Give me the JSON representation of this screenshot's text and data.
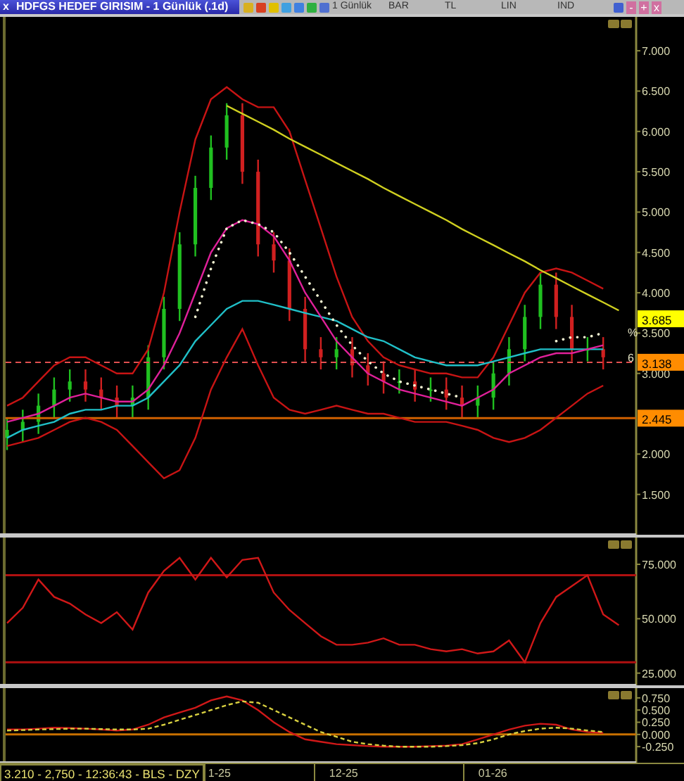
{
  "window": {
    "close": "x",
    "title": "HDFGS HEDEF GIRISIM - 1 Günlük (.1d)"
  },
  "toolbar": {
    "menus": [
      "1 Günlük",
      "BAR",
      "TL",
      "LIN",
      "IND"
    ],
    "window_buttons": [
      "-",
      "+",
      "x"
    ]
  },
  "panels": [
    {
      "layers": [
        {
          "chart_data": {
            "type": "candlestick",
            "ylim": [
              1.0,
              7.42
            ],
            "yticks": [
              {
                "value": 7,
                "label": "7.000"
              },
              {
                "value": 6.5,
                "label": "6.500"
              },
              {
                "value": 6,
                "label": "6.000"
              },
              {
                "value": 5.5,
                "label": "5.500"
              },
              {
                "value": 5,
                "label": "5.000"
              }
            ],
            "ohlc": [
              [
                2.2,
                2.45,
                2.05,
                2.3
              ],
              [
                2.3,
                2.55,
                2.15,
                2.4
              ],
              [
                2.4,
                2.75,
                2.25,
                2.6
              ],
              [
                2.6,
                2.95,
                2.45,
                2.8
              ],
              [
                2.8,
                3.05,
                2.65,
                2.9
              ],
              [
                2.9,
                3.05,
                2.65,
                2.8
              ],
              [
                2.8,
                2.95,
                2.55,
                2.7
              ],
              [
                2.7,
                2.85,
                2.45,
                2.6
              ],
              [
                2.6,
                2.85,
                2.45,
                2.7
              ],
              [
                2.7,
                3.35,
                2.55,
                3.2
              ],
              [
                3.2,
                3.95,
                3.05,
                3.8
              ],
              [
                3.8,
                4.75,
                3.65,
                4.6
              ],
              [
                4.6,
                5.45,
                4.45,
                5.3
              ],
              [
                5.3,
                5.95,
                5.15,
                5.8
              ],
              [
                5.8,
                6.35,
                5.65,
                6.2
              ],
              [
                6.2,
                6.35,
                5.35,
                5.5
              ],
              [
                5.5,
                5.65,
                4.45,
                4.6
              ],
              [
                4.6,
                4.75,
                4.25,
                4.4
              ],
              [
                4.4,
                4.55,
                3.65,
                3.8
              ],
              [
                3.8,
                3.95,
                3.15,
                3.3
              ],
              [
                3.3,
                3.45,
                3.05,
                3.2
              ],
              [
                3.2,
                3.45,
                3.05,
                3.3
              ],
              [
                3.3,
                3.45,
                2.95,
                3.1
              ],
              [
                3.1,
                3.25,
                2.85,
                3.0
              ],
              [
                3.0,
                3.15,
                2.75,
                2.9
              ],
              [
                2.9,
                3.05,
                2.75,
                2.9
              ],
              [
                2.9,
                3.05,
                2.65,
                2.8
              ],
              [
                2.8,
                2.95,
                2.65,
                2.8
              ],
              [
                2.8,
                2.95,
                2.55,
                2.7
              ],
              [
                2.7,
                2.85,
                2.45,
                2.6
              ],
              [
                2.6,
                2.85,
                2.45,
                2.7
              ],
              [
                2.7,
                3.15,
                2.55,
                3.0
              ],
              [
                3.0,
                3.45,
                2.85,
                3.3
              ],
              [
                3.3,
                3.85,
                3.15,
                3.7
              ],
              [
                3.7,
                4.25,
                3.55,
                4.1
              ],
              [
                4.1,
                4.25,
                3.55,
                3.7
              ],
              [
                3.7,
                3.85,
                3.15,
                3.3
              ],
              [
                3.3,
                3.45,
                3.15,
                3.3
              ],
              [
                3.3,
                3.45,
                3.05,
                3.2
              ]
            ]
          }
        },
        {
          "chart_data": {
            "type": "line",
            "ylim": [
              1.0,
              7.42
            ],
            "yticks": [
              {
                "value": 4.5,
                "label": "4.500"
              },
              {
                "value": 4,
                "label": "4.000"
              },
              {
                "value": 3.5,
                "label": "3.500"
              },
              {
                "value": 3,
                "label": "3.000"
              },
              {
                "value": 2,
                "label": "2.000"
              },
              {
                "value": 1.5,
                "label": "1.500"
              }
            ],
            "series": [
              {
                "color": "#c81414",
                "line_style": "solid",
                "values": [
                  2.6,
                  2.7,
                  2.9,
                  3.1,
                  3.2,
                  3.2,
                  3.1,
                  3.0,
                  3.0,
                  3.3,
                  4.0,
                  5.0,
                  5.9,
                  6.4,
                  6.55,
                  6.4,
                  6.3,
                  6.3,
                  6.0,
                  5.4,
                  4.8,
                  4.2,
                  3.7,
                  3.4,
                  3.2,
                  3.1,
                  3.05,
                  3.0,
                  3.0,
                  2.95,
                  2.95,
                  3.2,
                  3.6,
                  4.0,
                  4.25,
                  4.3,
                  4.25,
                  4.15,
                  4.05,
                  null
                ]
              },
              {
                "color": "#c81414",
                "line_style": "solid",
                "values": [
                  2.1,
                  2.15,
                  2.2,
                  2.3,
                  2.4,
                  2.45,
                  2.4,
                  2.3,
                  2.1,
                  1.9,
                  1.7,
                  1.8,
                  2.2,
                  2.8,
                  3.2,
                  3.55,
                  3.1,
                  2.7,
                  2.55,
                  2.5,
                  2.55,
                  2.6,
                  2.55,
                  2.5,
                  2.5,
                  2.45,
                  2.4,
                  2.4,
                  2.4,
                  2.35,
                  2.3,
                  2.2,
                  2.15,
                  2.2,
                  2.3,
                  2.45,
                  2.6,
                  2.75,
                  2.85,
                  null
                ]
              },
              {
                "color": "#20c0c8",
                "line_style": "solid",
                "values": [
                  2.2,
                  2.3,
                  2.35,
                  2.4,
                  2.5,
                  2.55,
                  2.55,
                  2.6,
                  2.6,
                  2.7,
                  2.9,
                  3.1,
                  3.4,
                  3.6,
                  3.8,
                  3.9,
                  3.9,
                  3.85,
                  3.8,
                  3.75,
                  3.7,
                  3.65,
                  3.55,
                  3.45,
                  3.4,
                  3.3,
                  3.2,
                  3.15,
                  3.1,
                  3.1,
                  3.1,
                  3.15,
                  3.2,
                  3.25,
                  3.3,
                  3.3,
                  3.3,
                  3.3,
                  3.3,
                  null
                ]
              },
              {
                "color": "#e0209a",
                "line_style": "solid",
                "values": [
                  2.4,
                  2.45,
                  2.5,
                  2.6,
                  2.7,
                  2.75,
                  2.7,
                  2.65,
                  2.65,
                  2.8,
                  3.1,
                  3.5,
                  4.0,
                  4.5,
                  4.8,
                  4.9,
                  4.85,
                  4.7,
                  4.4,
                  4.0,
                  3.7,
                  3.4,
                  3.2,
                  3.0,
                  2.9,
                  2.8,
                  2.75,
                  2.7,
                  2.65,
                  2.6,
                  2.7,
                  2.8,
                  3.0,
                  3.1,
                  3.2,
                  3.25,
                  3.25,
                  3.3,
                  3.35,
                  null
                ]
              },
              {
                "color": "#d0d020",
                "line_style": "solid",
                "values": [
                  null,
                  null,
                  null,
                  null,
                  null,
                  null,
                  null,
                  null,
                  null,
                  null,
                  null,
                  null,
                  null,
                  null,
                  6.32,
                  6.22,
                  6.12,
                  6.02,
                  5.91,
                  5.81,
                  5.71,
                  5.61,
                  5.51,
                  5.41,
                  5.3,
                  5.2,
                  5.1,
                  5.0,
                  4.9,
                  4.79,
                  4.69,
                  4.59,
                  4.49,
                  4.39,
                  4.28,
                  4.18,
                  4.08,
                  3.98,
                  3.88,
                  3.78
                ]
              },
              {
                "color": "#f0f0d0",
                "line_style": "dotted",
                "values": [
                  null,
                  null,
                  null,
                  null,
                  null,
                  null,
                  null,
                  null,
                  null,
                  null,
                  null,
                  null,
                  3.7,
                  4.3,
                  4.8,
                  4.9,
                  4.85,
                  4.75,
                  4.5,
                  4.2,
                  3.9,
                  3.6,
                  3.35,
                  3.15,
                  3.0,
                  2.9,
                  2.85,
                  2.8,
                  2.75,
                  2.7,
                  null,
                  null,
                  null,
                  null,
                  null,
                  3.4,
                  3.45,
                  3.45,
                  3.5,
                  null
                ]
              }
            ],
            "ref_lines": [
              {
                "axis": "y",
                "value": 3.138,
                "color": "#e05050",
                "line_style": "dashed",
                "label": "3.138"
              },
              {
                "axis": "y",
                "value": 2.445,
                "color": "#d06000",
                "line_style": "solid",
                "label": "2.445"
              }
            ]
          }
        }
      ],
      "tags": [
        "3.685"
      ],
      "markers": [
        "%",
        "6"
      ]
    },
    {
      "layers": [
        {
          "chart_data": {
            "type": "line",
            "ylim": [
              19.4,
              87.3
            ],
            "yticks": [
              {
                "value": 75,
                "label": "75.000"
              },
              {
                "value": 50,
                "label": "50.000"
              },
              {
                "value": 25,
                "label": "25.000"
              }
            ],
            "series": [
              {
                "color": "#d01818",
                "line_style": "solid",
                "values": [
                  48,
                  55,
                  68,
                  60,
                  57,
                  52,
                  48,
                  53,
                  45,
                  62,
                  72,
                  78,
                  68,
                  78,
                  69,
                  77,
                  78,
                  62,
                  54,
                  48,
                  42,
                  38,
                  38,
                  39,
                  41,
                  38,
                  38,
                  36,
                  35,
                  36,
                  34,
                  35,
                  40,
                  30,
                  48,
                  60,
                  65,
                  70,
                  52,
                  47
                ]
              }
            ],
            "ref_lines": [
              {
                "axis": "y",
                "value": 70,
                "color": "#b01010",
                "line_style": "solid"
              },
              {
                "axis": "y",
                "value": 30,
                "color": "#b01010",
                "line_style": "solid"
              }
            ]
          }
        }
      ]
    },
    {
      "layers": [
        {
          "chart_data": {
            "type": "line",
            "ylim": [
              -0.58,
              0.95
            ],
            "yticks": [
              {
                "value": 0.75,
                "label": "0.750"
              },
              {
                "value": 0.5,
                "label": "0.500"
              },
              {
                "value": 0.25,
                "label": "0.250"
              },
              {
                "value": 0,
                "label": "0.000"
              },
              {
                "value": -0.25,
                "label": "-0.250"
              }
            ],
            "series": [
              {
                "color": "#d01818",
                "line_style": "solid",
                "values": [
                  0.1,
                  0.1,
                  0.12,
                  0.14,
                  0.13,
                  0.12,
                  0.1,
                  0.08,
                  0.1,
                  0.2,
                  0.35,
                  0.45,
                  0.55,
                  0.7,
                  0.78,
                  0.7,
                  0.5,
                  0.25,
                  0.05,
                  -0.1,
                  -0.15,
                  -0.2,
                  -0.22,
                  -0.24,
                  -0.25,
                  -0.25,
                  -0.25,
                  -0.24,
                  -0.23,
                  -0.2,
                  -0.1,
                  0.0,
                  0.1,
                  0.18,
                  0.22,
                  0.2,
                  0.1,
                  0.05,
                  0.03,
                  null
                ]
              },
              {
                "color": "#d8d040",
                "line_style": "dashed",
                "values": [
                  0.08,
                  0.09,
                  0.1,
                  0.11,
                  0.12,
                  0.12,
                  0.11,
                  0.1,
                  0.1,
                  0.12,
                  0.2,
                  0.3,
                  0.4,
                  0.5,
                  0.6,
                  0.68,
                  0.65,
                  0.5,
                  0.35,
                  0.2,
                  0.05,
                  -0.05,
                  -0.15,
                  -0.2,
                  -0.23,
                  -0.25,
                  -0.25,
                  -0.25,
                  -0.24,
                  -0.22,
                  -0.18,
                  -0.1,
                  0.0,
                  0.07,
                  0.12,
                  0.14,
                  0.12,
                  0.08,
                  0.05,
                  null
                ]
              }
            ],
            "ref_lines": [
              {
                "axis": "y",
                "value": 0,
                "color": "#c87000",
                "line_style": "solid"
              }
            ]
          }
        }
      ]
    }
  ],
  "status": "3.210 - 2,750 - 12:36:43 - BLS - DZY",
  "time_axis": [
    "1-25",
    "12-25",
    "01-26"
  ]
}
